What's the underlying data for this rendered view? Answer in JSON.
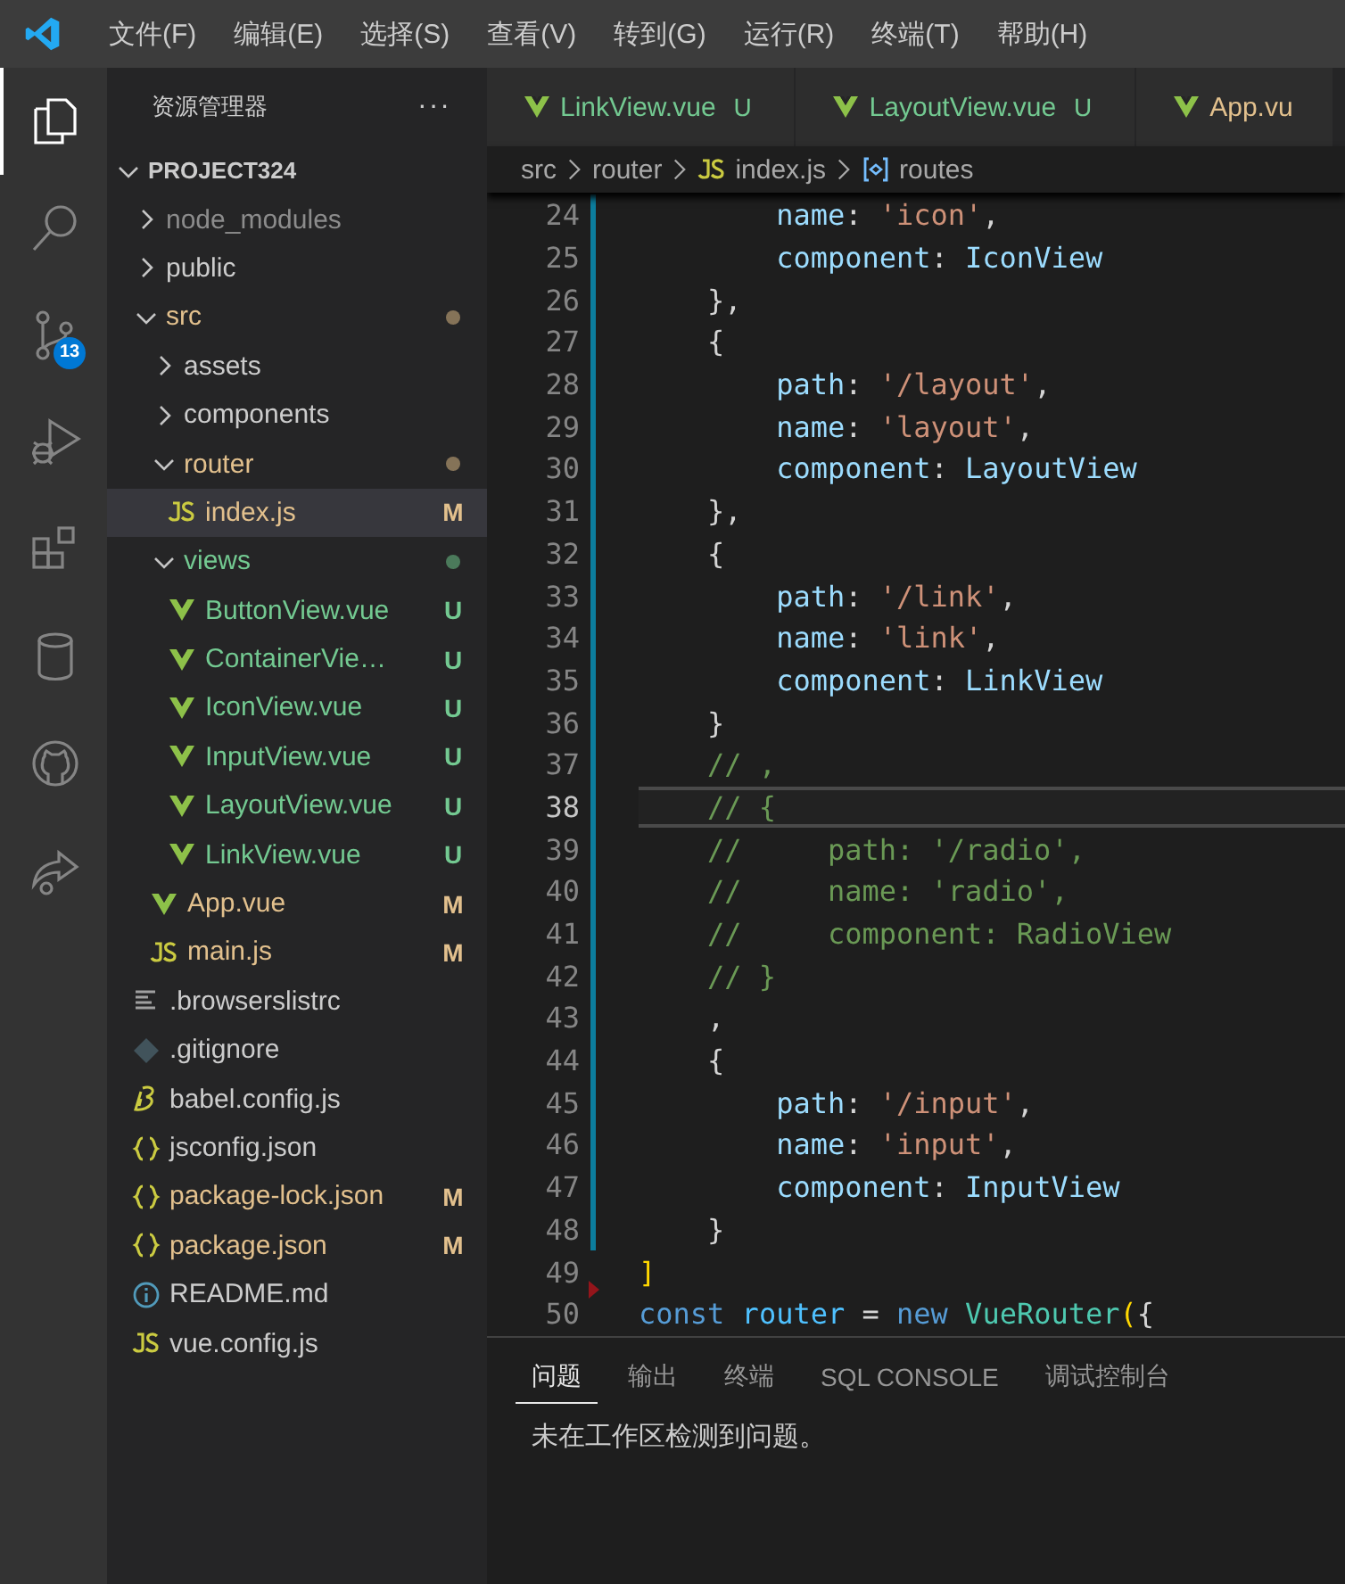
{
  "menu_bar": {
    "items": [
      "文件(F)",
      "编辑(E)",
      "选择(S)",
      "查看(V)",
      "转到(G)",
      "运行(R)",
      "终端(T)",
      "帮助(H)"
    ]
  },
  "activity_bar": {
    "items": [
      {
        "kind": "explorer",
        "selected": true
      },
      {
        "kind": "search",
        "selected": false
      },
      {
        "kind": "source-control",
        "selected": false,
        "badge": "13"
      },
      {
        "kind": "run-debug",
        "selected": false
      },
      {
        "kind": "extensions",
        "selected": false
      },
      {
        "kind": "database",
        "selected": false
      },
      {
        "kind": "github",
        "selected": false
      },
      {
        "kind": "share",
        "selected": false
      }
    ]
  },
  "sidebar": {
    "title": "资源管理器",
    "more": "···",
    "tree": {
      "label": "PROJECT324",
      "expanded": true,
      "children": [
        {
          "label": "node_modules",
          "kind": "folder",
          "expanded": false,
          "ignored": true,
          "selected": false
        },
        {
          "label": "public",
          "kind": "folder",
          "expanded": false,
          "selected": false
        },
        {
          "label": "src",
          "kind": "folder",
          "expanded": true,
          "modified": true,
          "selected": false,
          "children": [
            {
              "label": "assets",
              "kind": "folder",
              "expanded": false,
              "selected": false
            },
            {
              "label": "components",
              "kind": "folder",
              "expanded": false,
              "selected": false
            },
            {
              "label": "router",
              "kind": "folder",
              "expanded": true,
              "modified": true,
              "selected": false,
              "children": [
                {
                  "label": "index.js",
                  "kind": "js",
                  "modified": true,
                  "badge": "M",
                  "selected": true
                }
              ]
            },
            {
              "label": "views",
              "kind": "folder",
              "expanded": true,
              "untracked": true,
              "selected": false,
              "children": [
                {
                  "label": "ButtonView.vue",
                  "kind": "vue",
                  "untracked": true,
                  "badge": "U",
                  "selected": false
                },
                {
                  "label": "ContainerVie…",
                  "kind": "vue",
                  "untracked": true,
                  "badge": "U",
                  "selected": false
                },
                {
                  "label": "IconView.vue",
                  "kind": "vue",
                  "untracked": true,
                  "badge": "U",
                  "selected": false
                },
                {
                  "label": "InputView.vue",
                  "kind": "vue",
                  "untracked": true,
                  "badge": "U",
                  "selected": false
                },
                {
                  "label": "LayoutView.vue",
                  "kind": "vue",
                  "untracked": true,
                  "badge": "U",
                  "selected": false
                },
                {
                  "label": "LinkView.vue",
                  "kind": "vue",
                  "untracked": true,
                  "badge": "U",
                  "selected": false
                }
              ]
            },
            {
              "label": "App.vue",
              "kind": "vue",
              "modified": true,
              "badge": "M",
              "selected": false
            },
            {
              "label": "main.js",
              "kind": "js",
              "modified": true,
              "badge": "M",
              "selected": false
            }
          ]
        },
        {
          "label": ".browserslistrc",
          "kind": "text",
          "selected": false
        },
        {
          "label": ".gitignore",
          "kind": "git",
          "selected": false
        },
        {
          "label": "babel.config.js",
          "kind": "babel",
          "selected": false
        },
        {
          "label": "jsconfig.json",
          "kind": "json",
          "selected": false
        },
        {
          "label": "package-lock.json",
          "kind": "json",
          "modified": true,
          "badge": "M",
          "selected": false
        },
        {
          "label": "package.json",
          "kind": "json",
          "modified": true,
          "badge": "M",
          "selected": false
        },
        {
          "label": "README.md",
          "kind": "info",
          "selected": false
        },
        {
          "label": "vue.config.js",
          "kind": "js",
          "selected": false
        }
      ]
    }
  },
  "editor": {
    "tabs": [
      {
        "label": "LinkView.vue",
        "untracked": true,
        "badge": "U",
        "selected": false
      },
      {
        "label": "LayoutView.vue",
        "untracked": true,
        "badge": "U",
        "selected": false
      },
      {
        "label": "App.vu",
        "modified": true,
        "selected": false
      }
    ],
    "breadcrumb": [
      {
        "kind": "folder",
        "label": "src"
      },
      {
        "kind": "folder",
        "label": "router"
      },
      {
        "kind": "js",
        "label": "index.js"
      },
      {
        "kind": "symbol",
        "label": "routes"
      }
    ],
    "lines": [
      {
        "number": "24",
        "changed": true,
        "current": false,
        "tokens": [
          {
            "kind": "key",
            "text": "        name"
          },
          {
            "kind": "punct",
            "text": ": "
          },
          {
            "kind": "string",
            "text": "'icon'"
          },
          {
            "kind": "punct",
            "text": ","
          }
        ]
      },
      {
        "number": "25",
        "changed": true,
        "current": false,
        "tokens": [
          {
            "kind": "key",
            "text": "        component"
          },
          {
            "kind": "punct",
            "text": ": "
          },
          {
            "kind": "key",
            "text": "IconView"
          }
        ]
      },
      {
        "number": "26",
        "changed": true,
        "current": false,
        "tokens": [
          {
            "kind": "punct",
            "text": "    },"
          }
        ]
      },
      {
        "number": "27",
        "changed": true,
        "current": false,
        "tokens": [
          {
            "kind": "punct",
            "text": "    {"
          }
        ]
      },
      {
        "number": "28",
        "changed": true,
        "current": false,
        "tokens": [
          {
            "kind": "key",
            "text": "        path"
          },
          {
            "kind": "punct",
            "text": ": "
          },
          {
            "kind": "string",
            "text": "'/layout'"
          },
          {
            "kind": "punct",
            "text": ","
          }
        ]
      },
      {
        "number": "29",
        "changed": true,
        "current": false,
        "tokens": [
          {
            "kind": "key",
            "text": "        name"
          },
          {
            "kind": "punct",
            "text": ": "
          },
          {
            "kind": "string",
            "text": "'layout'"
          },
          {
            "kind": "punct",
            "text": ","
          }
        ]
      },
      {
        "number": "30",
        "changed": true,
        "current": false,
        "tokens": [
          {
            "kind": "key",
            "text": "        component"
          },
          {
            "kind": "punct",
            "text": ": "
          },
          {
            "kind": "key",
            "text": "LayoutView"
          }
        ]
      },
      {
        "number": "31",
        "changed": true,
        "current": false,
        "tokens": [
          {
            "kind": "punct",
            "text": "    },"
          }
        ]
      },
      {
        "number": "32",
        "changed": true,
        "current": false,
        "tokens": [
          {
            "kind": "punct",
            "text": "    {"
          }
        ]
      },
      {
        "number": "33",
        "changed": true,
        "current": false,
        "tokens": [
          {
            "kind": "key",
            "text": "        path"
          },
          {
            "kind": "punct",
            "text": ": "
          },
          {
            "kind": "string",
            "text": "'/link'"
          },
          {
            "kind": "punct",
            "text": ","
          }
        ]
      },
      {
        "number": "34",
        "changed": true,
        "current": false,
        "tokens": [
          {
            "kind": "key",
            "text": "        name"
          },
          {
            "kind": "punct",
            "text": ": "
          },
          {
            "kind": "string",
            "text": "'link'"
          },
          {
            "kind": "punct",
            "text": ","
          }
        ]
      },
      {
        "number": "35",
        "changed": true,
        "current": false,
        "tokens": [
          {
            "kind": "key",
            "text": "        component"
          },
          {
            "kind": "punct",
            "text": ": "
          },
          {
            "kind": "key",
            "text": "LinkView"
          }
        ]
      },
      {
        "number": "36",
        "changed": true,
        "current": false,
        "tokens": [
          {
            "kind": "punct",
            "text": "    }"
          }
        ]
      },
      {
        "number": "37",
        "changed": true,
        "current": false,
        "tokens": [
          {
            "kind": "comment",
            "text": "    // ,"
          }
        ]
      },
      {
        "number": "38",
        "changed": true,
        "current": true,
        "tokens": [
          {
            "kind": "comment",
            "text": "    // {"
          }
        ]
      },
      {
        "number": "39",
        "changed": true,
        "current": false,
        "tokens": [
          {
            "kind": "comment",
            "text": "    //     path: '/radio',"
          }
        ]
      },
      {
        "number": "40",
        "changed": true,
        "current": false,
        "tokens": [
          {
            "kind": "comment",
            "text": "    //     name: 'radio',"
          }
        ]
      },
      {
        "number": "41",
        "changed": true,
        "current": false,
        "tokens": [
          {
            "kind": "comment",
            "text": "    //     component: RadioView"
          }
        ]
      },
      {
        "number": "42",
        "changed": true,
        "current": false,
        "tokens": [
          {
            "kind": "comment",
            "text": "    // }"
          }
        ]
      },
      {
        "number": "43",
        "changed": true,
        "current": false,
        "tokens": [
          {
            "kind": "punct",
            "text": "    ,"
          }
        ]
      },
      {
        "number": "44",
        "changed": true,
        "current": false,
        "tokens": [
          {
            "kind": "punct",
            "text": "    {"
          }
        ]
      },
      {
        "number": "45",
        "changed": true,
        "current": false,
        "tokens": [
          {
            "kind": "key",
            "text": "        path"
          },
          {
            "kind": "punct",
            "text": ": "
          },
          {
            "kind": "string",
            "text": "'/input'"
          },
          {
            "kind": "punct",
            "text": ","
          }
        ]
      },
      {
        "number": "46",
        "changed": true,
        "current": false,
        "tokens": [
          {
            "kind": "key",
            "text": "        name"
          },
          {
            "kind": "punct",
            "text": ": "
          },
          {
            "kind": "string",
            "text": "'input'"
          },
          {
            "kind": "punct",
            "text": ","
          }
        ]
      },
      {
        "number": "47",
        "changed": true,
        "current": false,
        "tokens": [
          {
            "kind": "key",
            "text": "        component"
          },
          {
            "kind": "punct",
            "text": ": "
          },
          {
            "kind": "key",
            "text": "InputView"
          }
        ]
      },
      {
        "number": "48",
        "changed": true,
        "current": false,
        "tokens": [
          {
            "kind": "punct",
            "text": "    }"
          }
        ]
      },
      {
        "number": "49",
        "changed": false,
        "current": false,
        "tokens": [
          {
            "kind": "bracket",
            "text": "]"
          }
        ]
      },
      {
        "number": "50",
        "changed": false,
        "deleted": true,
        "current": false,
        "tokens": [
          {
            "kind": "keyword",
            "text": "const"
          },
          {
            "kind": "variable",
            "text": " router"
          },
          {
            "kind": "punct",
            "text": " = "
          },
          {
            "kind": "keyword",
            "text": "new"
          },
          {
            "kind": "type",
            "text": " VueRouter"
          },
          {
            "kind": "bracket",
            "text": "("
          },
          {
            "kind": "punct",
            "text": "{"
          }
        ]
      }
    ]
  },
  "panel": {
    "tabs": [
      {
        "label": "问题",
        "selected": true
      },
      {
        "label": "输出",
        "selected": false
      },
      {
        "label": "终端",
        "selected": false
      },
      {
        "label": "SQL CONSOLE",
        "selected": false
      },
      {
        "label": "调试控制台",
        "selected": false
      }
    ],
    "message": "未在工作区检测到问题。"
  }
}
